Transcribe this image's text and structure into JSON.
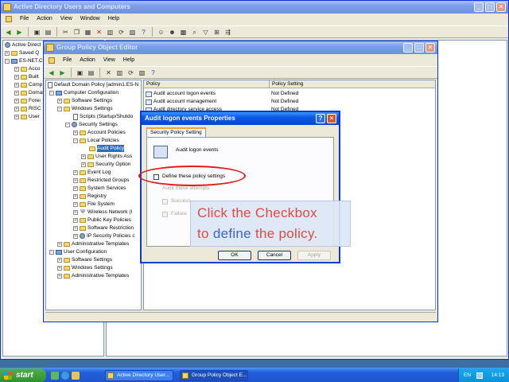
{
  "outer_window": {
    "title": "Active Directory Users and Computers",
    "menu": [
      "File",
      "Action",
      "View",
      "Window",
      "Help"
    ],
    "tree": [
      "Active Direct",
      "Saved Q",
      "ES-NET.C",
      "Acco",
      "Built",
      "Comp",
      "Domai",
      "Forei",
      "RISC",
      "User"
    ]
  },
  "gpo_window": {
    "title": "Group Policy Object Editor",
    "menu": [
      "File",
      "Action",
      "View",
      "Help"
    ],
    "tree": {
      "root": "Default Domain Policy [admin1.ES-N",
      "computer_config": "Computer Configuration",
      "software_settings": "Software Settings",
      "windows_settings": "Windows Settings",
      "scripts": "Scripts (Startup/Shutdo",
      "security_settings": "Security Settings",
      "account_policies": "Account Policies",
      "local_policies": "Local Policies",
      "audit_policy": "Audit Policy",
      "user_rights": "User Rights Ass",
      "security_options": "Security Option",
      "event_log": "Event Log",
      "restricted_groups": "Restricted Groups",
      "system_services": "System Services",
      "registry": "Registry",
      "file_system": "File System",
      "wireless": "Wireless Network (I",
      "public_key": "Public Key Policies",
      "software_restriction": "Software Restriction",
      "ip_security": "IP Security Policies c",
      "admin_templates_c": "Administrative Templates",
      "user_config": "User Configuration",
      "software_settings_u": "Software Settings",
      "windows_settings_u": "Windows Settings",
      "admin_templates_u": "Administrative Templates"
    },
    "list": {
      "col_policy": "Policy",
      "col_setting": "Policy Setting",
      "rows": [
        {
          "policy": "Audit account logon events",
          "setting": "Not Defined"
        },
        {
          "policy": "Audit account management",
          "setting": "Not Defined"
        },
        {
          "policy": "Audit directory service access",
          "setting": "Not Defined"
        }
      ]
    }
  },
  "dialog": {
    "title": "Audit logon events Properties",
    "tab": "Security Policy Setting",
    "policy_name": "Audit logon events",
    "define_label": "Define these policy settings",
    "audit_attempts_label": "Audit these attempts:",
    "success_label": "Success",
    "failure_label": "Failure",
    "ok_label": "OK",
    "cancel_label": "Cancel",
    "apply_label": "Apply"
  },
  "hint": {
    "line1": "Click the Checkbox",
    "line2_pre": "to ",
    "line2_word": "define",
    "line2_post": " the policy."
  },
  "taskbar": {
    "start_label": "start",
    "tasks": [
      "Active Directory User...",
      "Group Policy Object E..."
    ],
    "lang": "EN",
    "clock": "14:13"
  }
}
